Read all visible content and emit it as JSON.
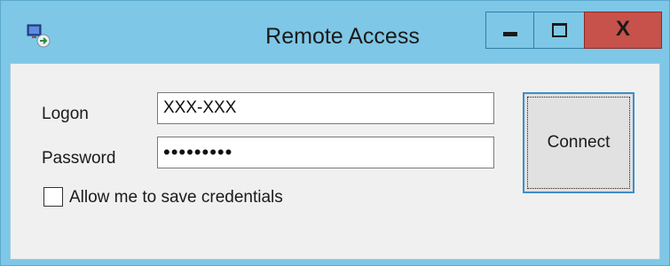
{
  "window": {
    "title": "Remote Access",
    "icon": "remote-access-app-icon",
    "controls": {
      "minimize_icon": "minimize-icon",
      "maximize_icon": "maximize-icon",
      "close_label": "X"
    },
    "colors": {
      "frame": "#7fc7e6",
      "close": "#c7514b",
      "client": "#f0f0f0"
    }
  },
  "form": {
    "logon_label": "Logon",
    "logon_value": "XXX-XXX",
    "password_label": "Password",
    "password_value": "•••••••••",
    "save_credentials_label": "Allow me to save credentials",
    "save_credentials_checked": false,
    "connect_label": "Connect"
  }
}
